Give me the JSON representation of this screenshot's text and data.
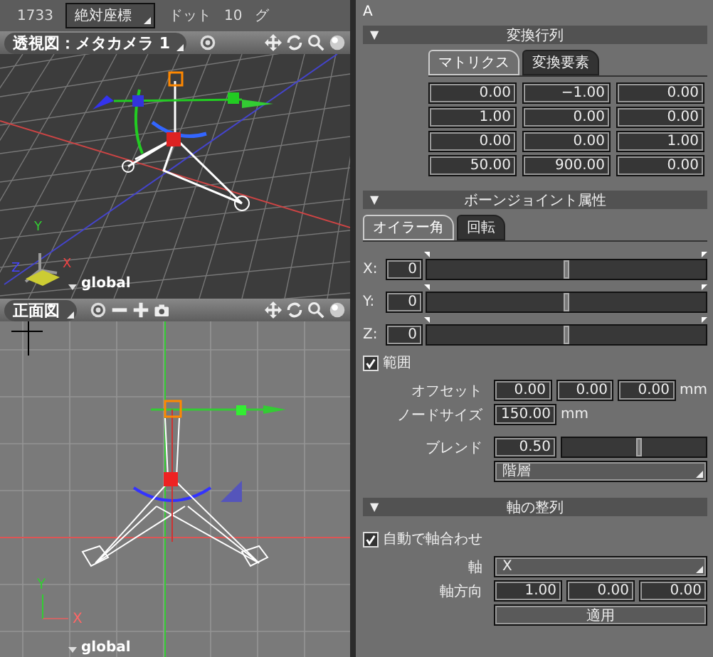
{
  "toolbar": {
    "count": "1733",
    "coordinate_mode": "絶対座標",
    "unit_label": "ドット",
    "grid_value": "10",
    "column_5": "グ"
  },
  "viewports": [
    {
      "kind": "perspective",
      "title": "透視図：メタカメラ 1",
      "axis_labels": [
        "Y",
        "Z",
        "X"
      ],
      "space": "global"
    },
    {
      "kind": "front",
      "title": "正面図",
      "axis_labels": [
        "Y",
        "X"
      ],
      "space": "global"
    }
  ],
  "inspector": {
    "object_name": "A",
    "transform": {
      "toggle": "▼",
      "title": "変換行列",
      "tabs": [
        {
          "label": "マトリクス",
          "selected": true
        },
        {
          "label": "変換要素",
          "selected": false
        }
      ],
      "matrix": [
        [
          "0.00",
          "−1.00",
          "0.00"
        ],
        [
          "1.00",
          "0.00",
          "0.00"
        ],
        [
          "0.00",
          "0.00",
          "1.00"
        ],
        [
          "50.00",
          "900.00",
          "0.00"
        ]
      ]
    },
    "bone_joint": {
      "toggle": "▼",
      "title": "ボーンジョイント属性",
      "tabs": [
        {
          "label": "オイラー角",
          "selected": true
        },
        {
          "label": "回転",
          "selected": false
        }
      ],
      "angles": [
        {
          "label": "X:",
          "value": "0",
          "level": 0.5
        },
        {
          "label": "Y:",
          "value": "0",
          "level": 0.5
        },
        {
          "label": "Z:",
          "value": "0",
          "level": 0.5
        }
      ],
      "range": {
        "label": "範囲",
        "checked": true
      },
      "offset": {
        "label": "オフセット",
        "values": [
          "0.00",
          "0.00",
          "0.00"
        ],
        "unit": "mm"
      },
      "node_size": {
        "label": "ノードサイズ",
        "value": "150.00",
        "unit": "mm"
      },
      "blend": {
        "label": "ブレンド",
        "value": "0.50",
        "level": 0.53
      },
      "mode": {
        "value": "階層"
      }
    },
    "axis_alignment": {
      "toggle": "▼",
      "title": "軸の整列",
      "auto_align": {
        "label": "自動で軸合わせ",
        "checked": true
      },
      "axis": {
        "label": "軸",
        "value": "X"
      },
      "direction": {
        "label": "軸方向",
        "values": [
          "1.00",
          "0.00",
          "0.00"
        ]
      },
      "apply_button": "適用"
    }
  }
}
